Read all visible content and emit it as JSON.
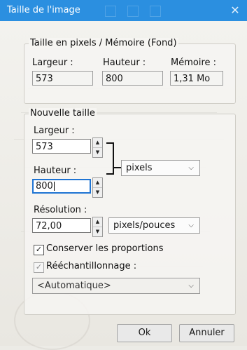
{
  "window": {
    "title": "Taille de l'image",
    "close_glyph": "✕"
  },
  "pixels_memory": {
    "legend": "Taille en pixels / Mémoire (Fond)",
    "width_label": "Largeur :",
    "height_label": "Hauteur :",
    "memory_label": "Mémoire :",
    "width_value": "573",
    "height_value": "800",
    "memory_value": "1,31 Mo"
  },
  "new_size": {
    "legend": "Nouvelle taille",
    "width_label": "Largeur :",
    "width_value": "573",
    "height_label": "Hauteur :",
    "height_value": "800",
    "unit_selected": "pixels",
    "resolution_label": "Résolution :",
    "resolution_value": "72,00",
    "resolution_unit": "pixels/pouces"
  },
  "options": {
    "keep_proportions_label": "Conserver les proportions",
    "keep_proportions_checked": true,
    "resample_label": "Rééchantillonnage :",
    "resample_checked": true,
    "resample_method": "<Automatique>"
  },
  "buttons": {
    "ok": "Ok",
    "cancel": "Annuler"
  },
  "icons": {
    "spin_up": "▲",
    "spin_down": "▼",
    "dropdown": "⌵",
    "check": "✓"
  },
  "colors": {
    "titlebar": "#2b8fe0",
    "focus": "#1f74d3"
  }
}
